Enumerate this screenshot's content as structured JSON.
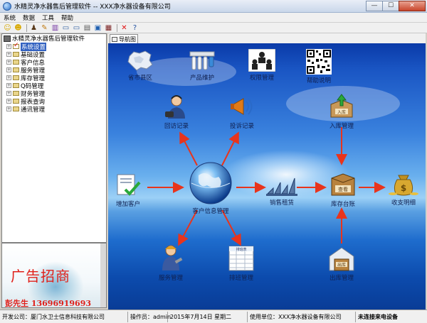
{
  "window": {
    "title": "水精灵净水器售后管理软件 -- XXX净水器设备有限公司",
    "minimize": "—",
    "maximize": "☐",
    "close": "✕"
  },
  "menu": [
    "系统",
    "数据",
    "工具",
    "帮助"
  ],
  "toolbar_icons": [
    "smiley-icon",
    "smiley-icon",
    "users-icon",
    "pen-icon",
    "bars-icon",
    "screen-icon",
    "screen-icon",
    "printer-icon",
    "window-icon",
    "grid-icon",
    "close-icon",
    "help-icon"
  ],
  "tree": {
    "root": "水精灵净水器售后管理软件",
    "items": [
      {
        "label": "系统设置",
        "selected": true
      },
      {
        "label": "基础设置"
      },
      {
        "label": "客户信息"
      },
      {
        "label": "服务管理"
      },
      {
        "label": "库存管理"
      },
      {
        "label": "Q码管理"
      },
      {
        "label": "财务管理"
      },
      {
        "label": "报表查询"
      },
      {
        "label": "通讯管理"
      }
    ]
  },
  "ad": {
    "title": "广告招商",
    "contact": "彭先生 13696919693"
  },
  "tab": {
    "label": "导航图"
  },
  "nav": {
    "top_row": [
      "省市县区",
      "产品维护",
      "权限管理",
      "帮助说明"
    ],
    "revisit": "回访记录",
    "complaint": "投诉记录",
    "stock_in": "入库管理",
    "add_customer": "增加客户",
    "customer_info": "客户信息管理",
    "sales": "销售租赁",
    "stock_ledger": "库存台账",
    "stock_ledger_badge": "查看",
    "finance": "收支明细",
    "service": "服务管理",
    "dispatch": "排班管理",
    "dispatch_badge": "排班表",
    "stock_out": "出库管理",
    "stock_out_badge": "出库",
    "stock_in_badge": "入库"
  },
  "status": {
    "developer": "开发公司：厦门水卫士信息科技有限公司",
    "operator": "操作员：admin",
    "date": "2015年7月14日  星期二",
    "unit": "使用单位：XXX净水器设备有限公司",
    "device": "未连接来电设备"
  },
  "colors": {
    "arrow": "#e8341c",
    "sea_top": "#0a3aa8",
    "sea_horizon": "#9cd0f6"
  }
}
